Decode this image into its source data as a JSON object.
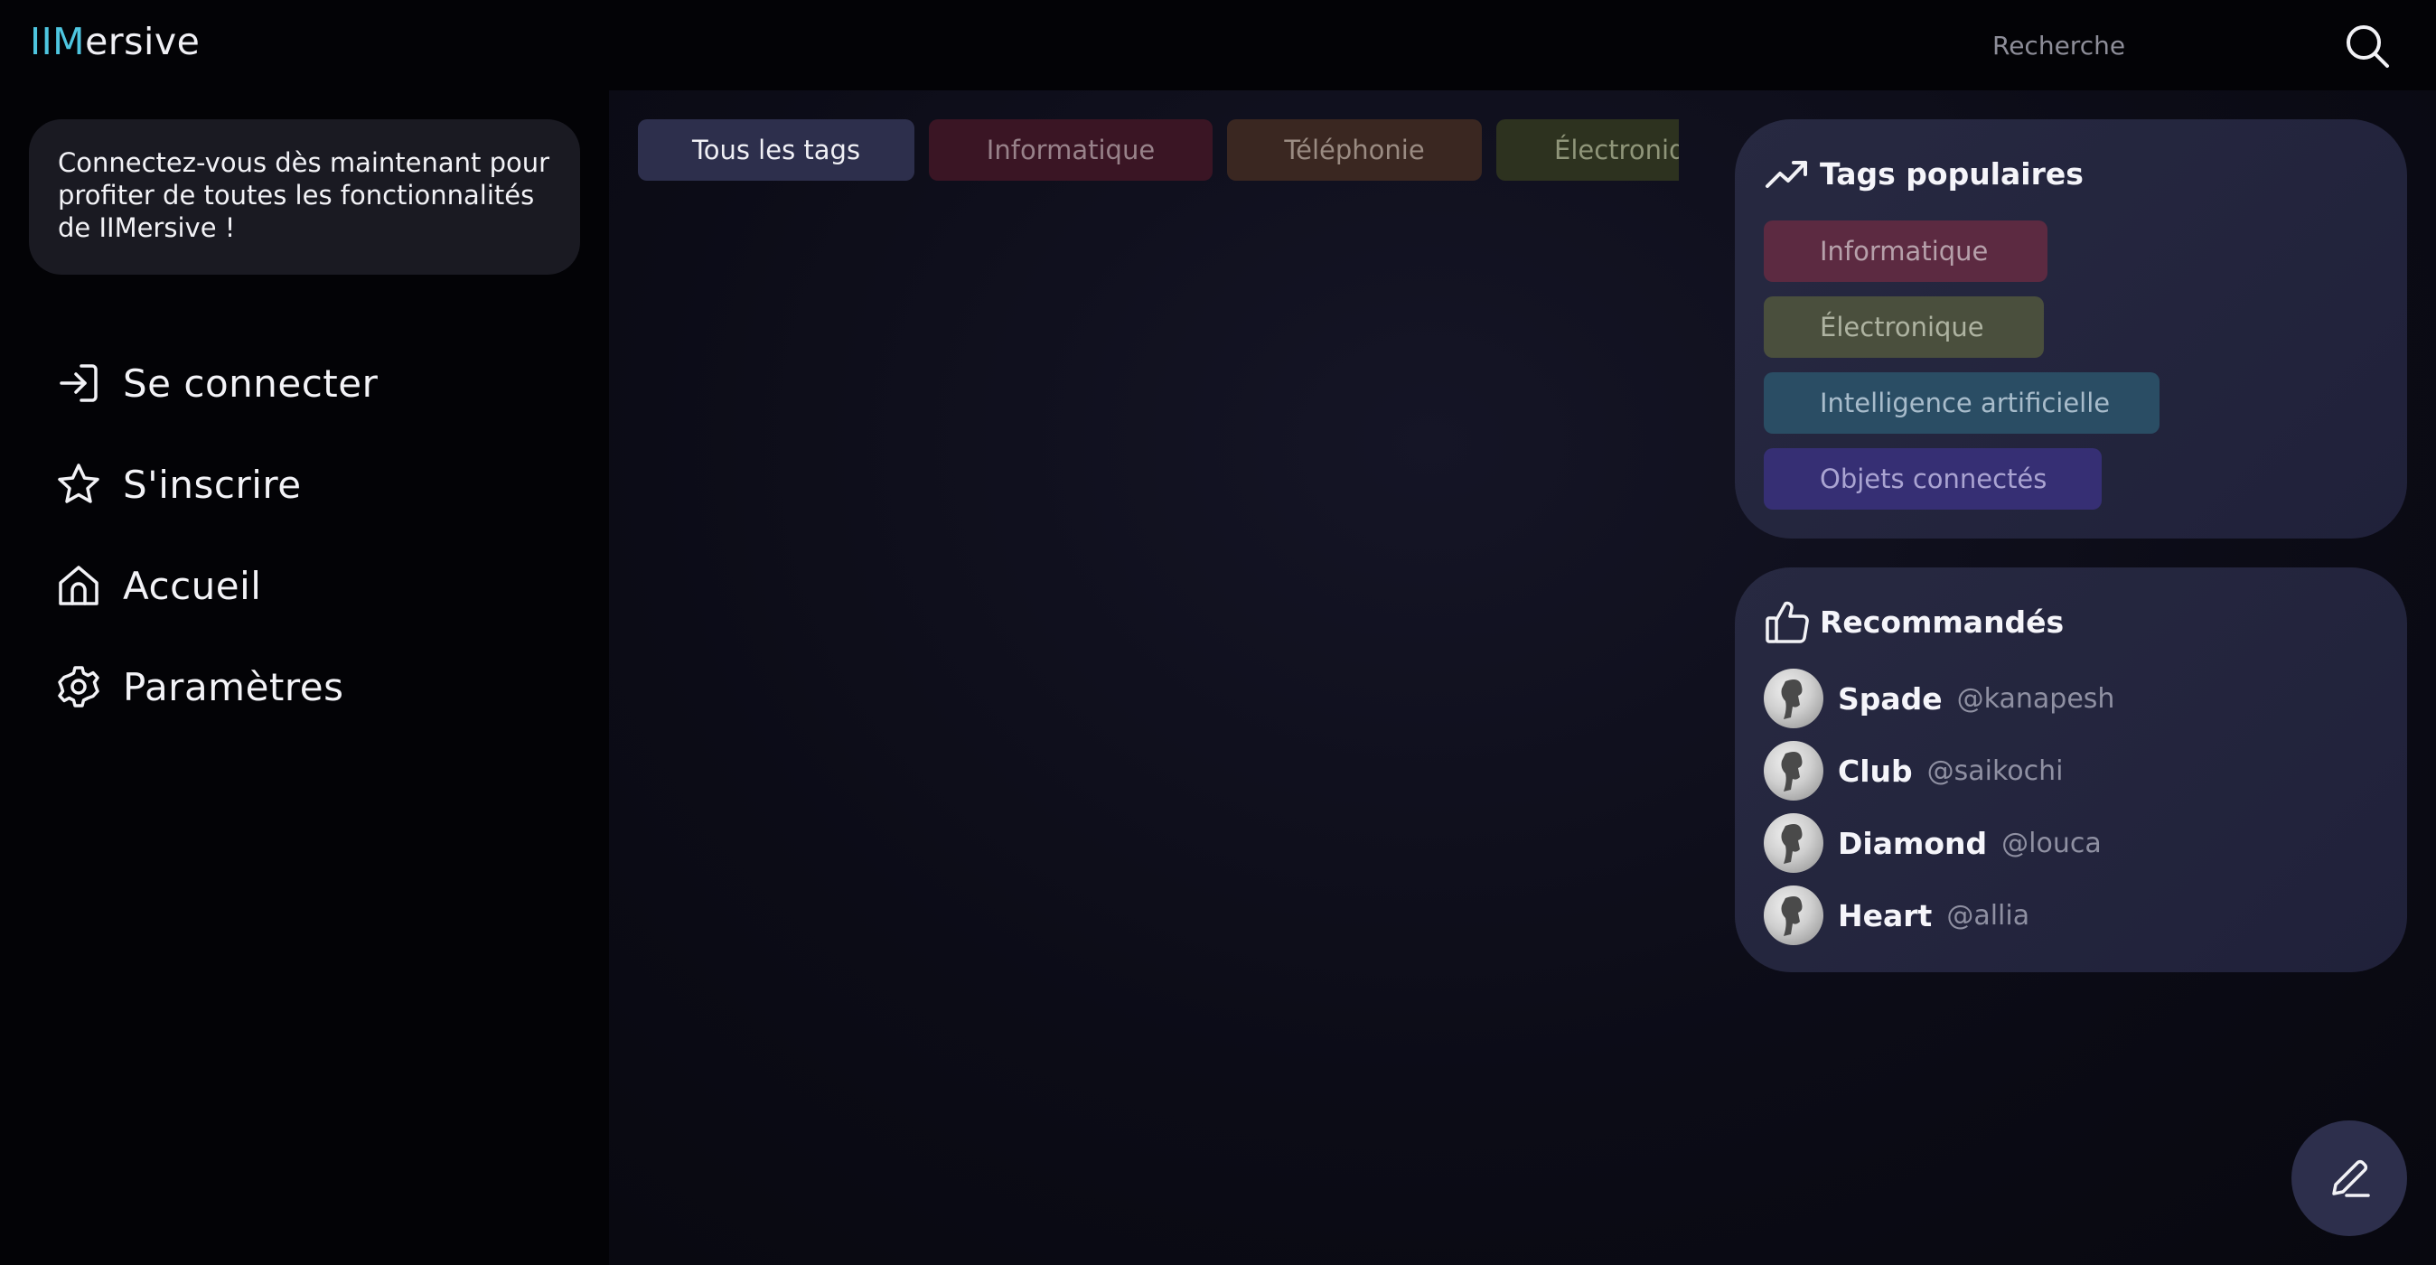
{
  "header": {
    "logo_accent": "IIM",
    "logo_rest": "ersive",
    "search_placeholder": "Recherche"
  },
  "sidebar": {
    "login_prompt": "Connectez-vous dès maintenant pour profiter de toutes les fonctionnalités de IIMersive !",
    "items": [
      {
        "label": "Se connecter",
        "icon": "login-icon"
      },
      {
        "label": "S'inscrire",
        "icon": "star-icon"
      },
      {
        "label": "Accueil",
        "icon": "home-icon"
      },
      {
        "label": "Paramètres",
        "icon": "gear-icon"
      }
    ]
  },
  "tags": {
    "items": [
      "Tous les tags",
      "Informatique",
      "Téléphonie",
      "Électronique"
    ]
  },
  "popular_tags": {
    "title": "Tags populaires",
    "icon": "trending-up-icon",
    "items": [
      "Informatique",
      "Électronique",
      "Intelligence artificielle",
      "Objets connectés"
    ]
  },
  "recommended": {
    "title": "Recommandés",
    "icon": "thumbs-up-icon",
    "users": [
      {
        "name": "Spade",
        "handle": "@kanapesh"
      },
      {
        "name": "Club",
        "handle": "@saikochi"
      },
      {
        "name": "Diamond",
        "handle": "@louca"
      },
      {
        "name": "Heart",
        "handle": "@allia"
      }
    ]
  },
  "fab": {
    "icon": "pencil-icon"
  },
  "colors": {
    "accent": "#4ec6e0",
    "background": "#07070d",
    "card": "#23253d"
  }
}
